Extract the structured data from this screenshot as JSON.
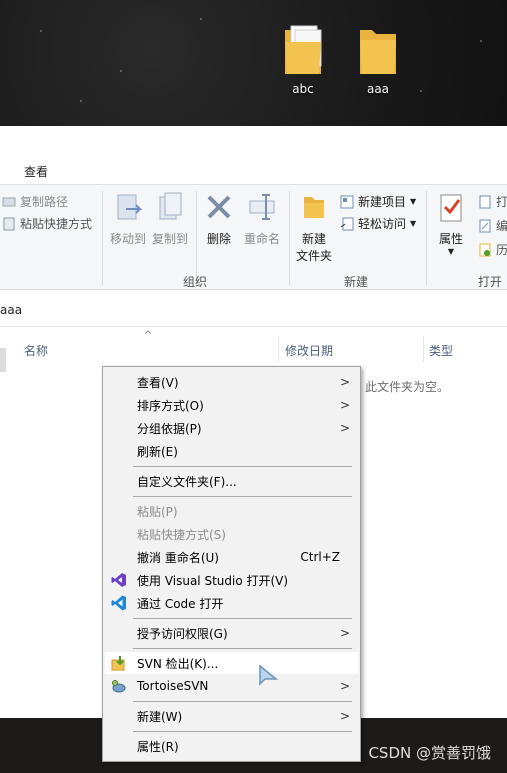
{
  "desktop": {
    "icons": [
      {
        "label": "abc",
        "icon": "folder-with-files-icon"
      },
      {
        "label": "aaa",
        "icon": "folder-icon"
      }
    ]
  },
  "ribbon": {
    "active_tab": "查看",
    "clipboard": {
      "copy_path": "复制路径",
      "paste_shortcut": "粘贴快捷方式"
    },
    "organize": {
      "move_to": "移动到",
      "copy_to": "复制到",
      "delete": "删除",
      "rename": "重命名",
      "label": "组织"
    },
    "new": {
      "new_folder_line1": "新建",
      "new_folder_line2": "文件夹",
      "new_item": "新建项目",
      "easy_access": "轻松访问",
      "label": "新建"
    },
    "open": {
      "properties": "属性",
      "open": "打",
      "edit": "编",
      "history": "历",
      "label": "打开"
    }
  },
  "address": {
    "path": "aaa"
  },
  "columns": {
    "name": "名称",
    "modified": "修改日期",
    "type": "类型"
  },
  "empty_message": "此文件夹为空。",
  "context_menu": {
    "items": [
      {
        "label": "查看(V)",
        "submenu": true
      },
      {
        "label": "排序方式(O)",
        "submenu": true
      },
      {
        "label": "分组依据(P)",
        "submenu": true
      },
      {
        "label": "刷新(E)"
      },
      {
        "label": "自定义文件夹(F)..."
      },
      {
        "label": "粘贴(P)",
        "disabled": true
      },
      {
        "label": "粘贴快捷方式(S)",
        "disabled": true
      },
      {
        "label": "撤消 重命名(U)",
        "accel": "Ctrl+Z"
      },
      {
        "label": "使用 Visual Studio 打开(V)",
        "icon": "visual-studio-icon"
      },
      {
        "label": "通过 Code 打开",
        "icon": "vscode-icon"
      },
      {
        "label": "授予访问权限(G)",
        "submenu": true
      },
      {
        "label": "SVN 检出(K)...",
        "icon": "svn-checkout-icon"
      },
      {
        "label": "TortoiseSVN",
        "icon": "tortoisesvn-icon",
        "submenu": true
      },
      {
        "label": "新建(W)",
        "submenu": true
      },
      {
        "label": "属性(R)"
      }
    ],
    "submenu_arrow": "〉"
  },
  "watermark": "CSDN @赏善罚饿",
  "colors": {
    "folder": "#f3c34f",
    "vs_purple": "#6c3ec1",
    "vscode_blue": "#1e88d6",
    "svn_green": "#4a9e2a"
  }
}
